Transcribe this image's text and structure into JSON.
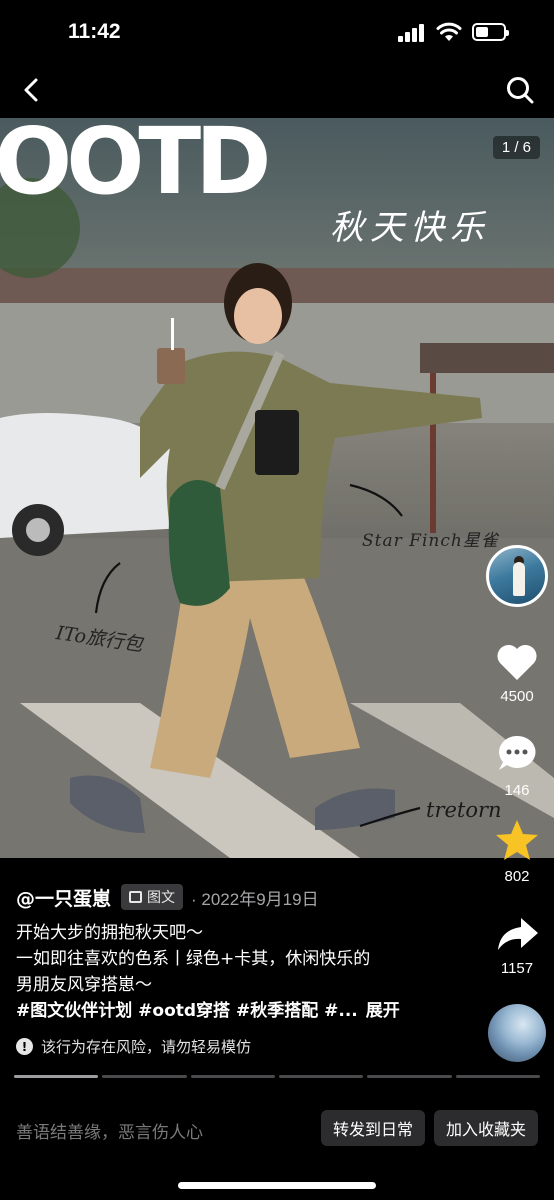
{
  "status": {
    "time": "11:42"
  },
  "nav": {
    "back_icon": "chevron-left-icon",
    "search_icon": "search-icon"
  },
  "photo": {
    "overlay_title": "OOTD",
    "handwritten_title": "秋天快乐",
    "annotation_brand": "Star Finch星雀",
    "annotation_bag": "ITo旅行包",
    "annotation_shoes": "tretorn",
    "page_counter": "1 / 6"
  },
  "actions": {
    "like_count": "4500",
    "comment_count": "146",
    "favorite_count": "802",
    "share_count": "1157",
    "like_icon": "heart-icon",
    "comment_icon": "comment-bubble-icon",
    "favorite_icon": "star-icon",
    "share_icon": "share-arrow-icon",
    "favorite_color": "#f7c325"
  },
  "post": {
    "author": "@一只蛋崽",
    "type_label": "图文",
    "date": "· 2022年9月19日",
    "line1": "开始大步的拥抱秋天吧～",
    "line2": "一如即往喜欢的色系丨绿色+卡其，休闲快乐的",
    "line3": "男朋友风穿搭崽～",
    "tags": "#图文伙伴计划 #ootd穿搭 #秋季搭配 #...",
    "expand": "展开",
    "risk_notice": "该行为存在风险，请勿轻易模仿"
  },
  "progress": {
    "total": 6,
    "current": 1
  },
  "bottom": {
    "comment_placeholder": "善语结善缘，恶言伤人心",
    "forward_label": "转发到日常",
    "collect_label": "加入收藏夹"
  }
}
